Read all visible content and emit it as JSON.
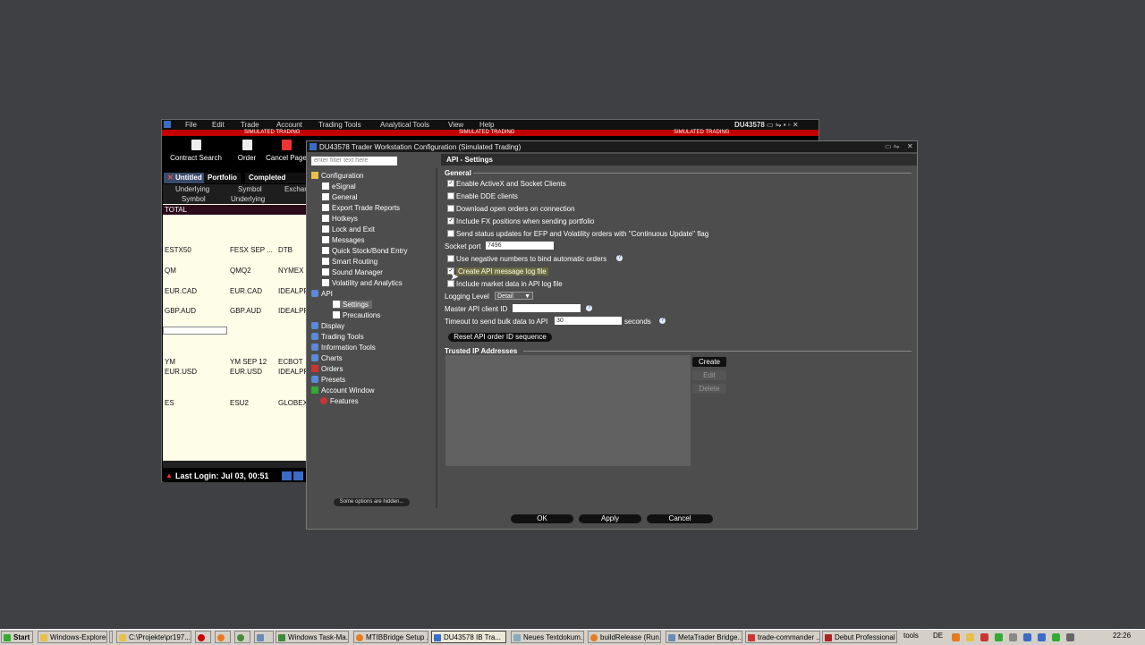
{
  "tws": {
    "menu": [
      "File",
      "Edit",
      "Trade",
      "Account",
      "Trading Tools",
      "Analytical Tools",
      "View",
      "Help"
    ],
    "account_id": "DU43578",
    "sim_banner": "SIMULATED TRADING",
    "toolbar": [
      "Contract Search",
      "Order",
      "Cancel Page"
    ],
    "tabs": [
      "Untitled",
      "Portfolio",
      "Completed Orders"
    ],
    "headers": {
      "row1": [
        "Underlying",
        "Symbol",
        "Exchange"
      ],
      "row2": [
        "Symbol",
        "Underlying"
      ]
    },
    "total_label": "TOTAL",
    "rows": [
      [
        "ESTX50",
        "FESX SEP ...",
        "DTB"
      ],
      [
        "QM",
        "QMQ2",
        "NYMEX"
      ],
      [
        "EUR.CAD",
        "EUR.CAD",
        "IDEALPRO"
      ],
      [
        "GBP.AUD",
        "GBP.AUD",
        "IDEALPRO"
      ],
      [
        "YM",
        "YM   SEP 12",
        "ECBOT"
      ],
      [
        "EUR.USD",
        "EUR.USD",
        "IDEALPRO"
      ],
      [
        "ES",
        "ESU2",
        "GLOBEX"
      ]
    ],
    "last_login": "Last Login: Jul 03, 00:51"
  },
  "dialog": {
    "title": "DU43578 Trader Workstation Configuration (Simulated Trading)",
    "filter_placeholder": "enter filter text here",
    "tree": {
      "root": "Configuration",
      "children": [
        "eSignal",
        "General",
        "Export Trade Reports",
        "Hotkeys",
        "Lock and Exit",
        "Messages",
        "Quick Stock/Bond Entry",
        "Smart Routing",
        "Sound Manager",
        "Volatility and Analytics"
      ],
      "api": "API",
      "api_children": [
        "Settings",
        "Precautions"
      ],
      "groups": [
        "Display",
        "Trading Tools",
        "Information Tools",
        "Charts",
        "Orders",
        "Presets",
        "Account Window",
        "Features"
      ]
    },
    "hidden_options": "Some options are hidden...",
    "panel_title": "API - Settings",
    "section_general": "General",
    "checkboxes": [
      {
        "label": "Enable ActiveX and Socket Clients",
        "checked": true
      },
      {
        "label": "Enable DDE clients",
        "checked": false
      },
      {
        "label": "Download open orders on connection",
        "checked": false
      },
      {
        "label": "Include FX positions when sending portfolio",
        "checked": true
      },
      {
        "label": "Send status updates for EFP and Volatility orders with \"Continuous Update\" flag",
        "checked": false
      }
    ],
    "socket_port_label": "Socket port",
    "socket_port": "7496",
    "checkboxes2": [
      {
        "label": "Use negative numbers to bind automatic orders",
        "checked": false
      },
      {
        "label": "Create API message log file",
        "checked": true
      },
      {
        "label": "Include market data in API log file",
        "checked": false
      }
    ],
    "logging_level_label": "Logging Level",
    "logging_level": "Detail",
    "master_client_label": "Master API client ID",
    "master_client": "",
    "timeout_label": "Timeout to send bulk data to API",
    "timeout_value": "30",
    "timeout_unit": "seconds",
    "reset_btn": "Reset API order ID sequence",
    "trusted_ip_label": "Trusted IP Addresses",
    "ip_buttons": [
      "Create",
      "Edit",
      "Delete"
    ],
    "footer": [
      "OK",
      "Apply",
      "Cancel"
    ]
  },
  "taskbar": {
    "start": "Start",
    "items": [
      "Windows-Explorer",
      "C:\\Projekte\\pr197...",
      "",
      "",
      "",
      "",
      "Windows Task-Ma...",
      "MTIBBridge Setup ...",
      "DU43578 IB Tra...",
      "Neues Textdokum...",
      "buildRelease (Run...",
      "MetaTrader Bridge...",
      "trade-commander ...",
      "Debut Professional"
    ],
    "tools": "tools",
    "lang": "DE",
    "clock": "22:26"
  }
}
